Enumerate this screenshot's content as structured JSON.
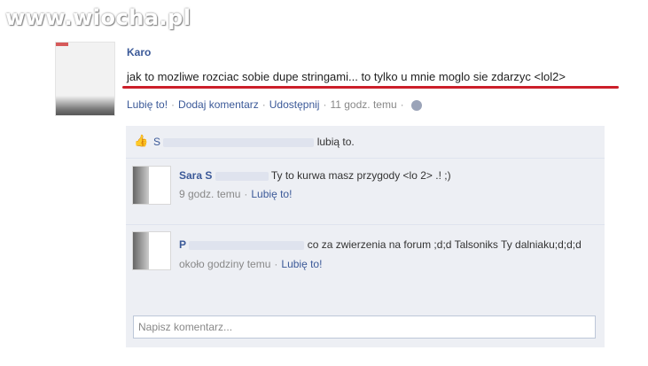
{
  "watermark": "www.wiocha.pl",
  "post": {
    "author": "Karo",
    "text": "jak to mozliwe rozciac sobie dupe stringami... to tylko u mnie moglo sie zdarzyc <lol2>",
    "actions": {
      "like": "Lubię to!",
      "comment": "Dodaj komentarz",
      "share": "Udostępnij",
      "time": "11 godz. temu"
    }
  },
  "likes": {
    "names": "S",
    "suffix": "lubią to."
  },
  "comments": [
    {
      "author": "Sara S",
      "text": "Ty to kurwa masz przygody <lo 2> .! ;)",
      "time": "9 godz. temu",
      "like": "Lubię to!"
    },
    {
      "author": "P",
      "text": "co za zwierzenia na forum ;d;d Talsoniks Ty dalniaku;d;d;d",
      "time": "około godziny temu",
      "like": "Lubię to!"
    }
  ],
  "comment_input": {
    "placeholder": "Napisz komentarz..."
  },
  "colors": {
    "link": "#3b5998",
    "underline": "#cc1f2a",
    "comment_bg": "#edeff4"
  }
}
